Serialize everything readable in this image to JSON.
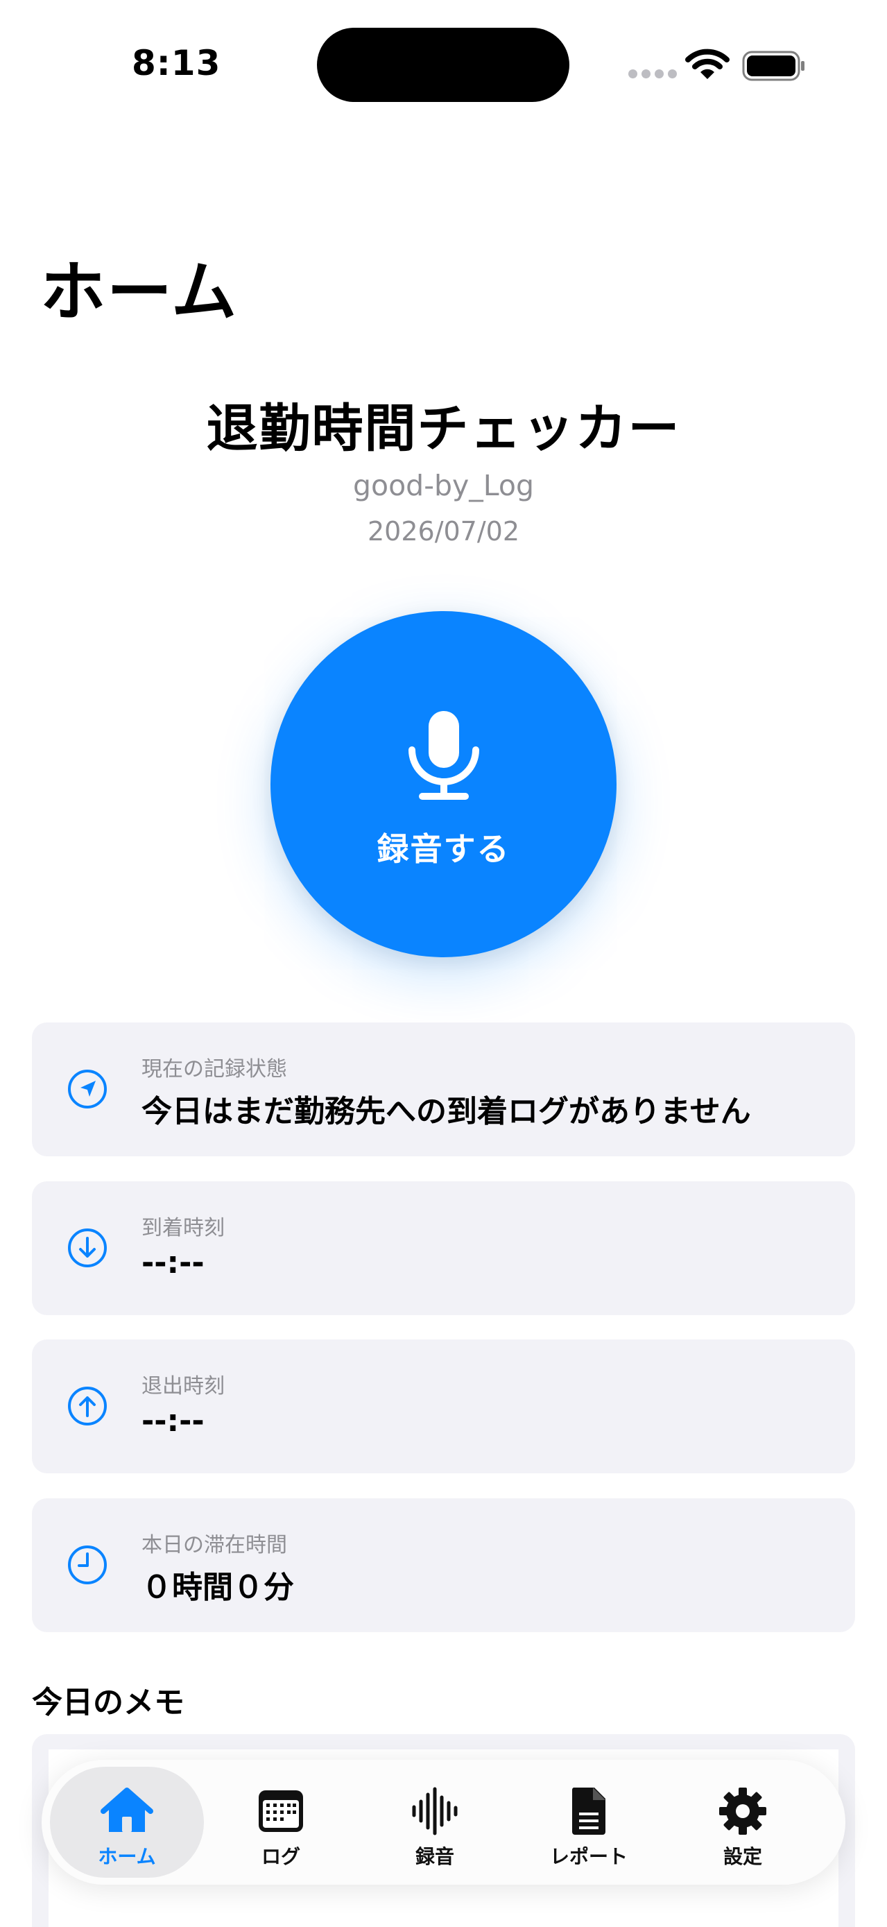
{
  "status_bar": {
    "time": "8:13"
  },
  "header": {
    "page_title": "ホーム",
    "app_title": "退勤時間チェッカー",
    "app_subtitle": "good-by_Log",
    "date": "2026/07/02"
  },
  "record_button": {
    "label": "録音する",
    "icon": "microphone-icon"
  },
  "cards": [
    {
      "label": "現在の記録状態",
      "value": "今日はまだ勤務先への到着ログがありません",
      "icon": "location-arrow-icon"
    },
    {
      "label": "到着時刻",
      "value": "--:--",
      "icon": "arrow-down-circle-icon"
    },
    {
      "label": "退出時刻",
      "value": "--:--",
      "icon": "arrow-up-circle-icon"
    },
    {
      "label": "本日の滞在時間",
      "value": "０時間０分",
      "icon": "clock-icon"
    }
  ],
  "memo": {
    "heading": "今日のメモ"
  },
  "tab_bar": {
    "tabs": [
      {
        "label": "ホーム",
        "icon": "house-icon",
        "active": true
      },
      {
        "label": "ログ",
        "icon": "calendar-icon",
        "active": false
      },
      {
        "label": "録音",
        "icon": "waveform-icon",
        "active": false
      },
      {
        "label": "レポート",
        "icon": "document-icon",
        "active": false
      },
      {
        "label": "設定",
        "icon": "gear-icon",
        "active": false
      }
    ]
  },
  "colors": {
    "accent": "#0a84ff",
    "card_bg": "#f2f2f7",
    "secondary_text": "#8e8e93"
  }
}
